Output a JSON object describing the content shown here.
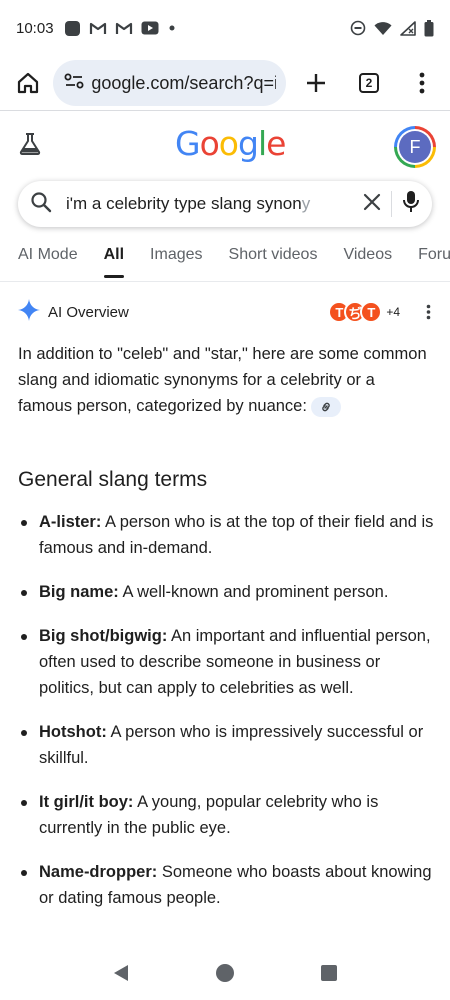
{
  "status_bar": {
    "time": "10:03",
    "icons_left": [
      "app-icon",
      "gmail-icon",
      "gmail-icon",
      "youtube-icon",
      "dot-icon"
    ],
    "icons_right": [
      "dnd-icon",
      "wifi-icon",
      "signal-icon",
      "battery-icon"
    ]
  },
  "browser": {
    "url": "google.com/search?q=i%",
    "tab_count": "2"
  },
  "header": {
    "logo": [
      {
        "ch": "G",
        "color": "#4285F4"
      },
      {
        "ch": "o",
        "color": "#EA4335"
      },
      {
        "ch": "o",
        "color": "#FBBC05"
      },
      {
        "ch": "g",
        "color": "#4285F4"
      },
      {
        "ch": "l",
        "color": "#34A853"
      },
      {
        "ch": "e",
        "color": "#EA4335"
      }
    ],
    "avatar_initial": "F"
  },
  "search": {
    "query": "i'm a celebrity type slang synony",
    "query_visible": "i'm a celebrity type slang synon",
    "query_faded": "y"
  },
  "tabs": [
    {
      "label": "AI Mode",
      "active": false
    },
    {
      "label": "All",
      "active": true
    },
    {
      "label": "Images",
      "active": false
    },
    {
      "label": "Short videos",
      "active": false
    },
    {
      "label": "Videos",
      "active": false
    },
    {
      "label": "Forur",
      "active": false
    }
  ],
  "ai_overview": {
    "title": "AI Overview",
    "sources_more": "+4",
    "source_badges": [
      "T",
      "ぢ",
      "T"
    ],
    "intro": "In addition to \"celeb\" and \"star,\" here are some common slang and idiomatic synonyms for a celebrity or a famous person, categorized by nuance:",
    "section_title": "General slang terms",
    "terms": [
      {
        "name": "A-lister:",
        "desc": " A person who is at the top of their field and is famous and in-demand."
      },
      {
        "name": "Big name:",
        "desc": " A well-known and prominent person."
      },
      {
        "name": "Big shot/bigwig:",
        "desc": " An important and influential person, often used to describe someone in business or politics, but can apply to celebrities as well."
      },
      {
        "name": "Hotshot:",
        "desc": " A person who is impressively successful or skillful."
      },
      {
        "name": "It girl/it boy:",
        "desc": " A young, popular celebrity who is currently in the public eye."
      },
      {
        "name": "Name-dropper:",
        "desc": " Someone who boasts about knowing or dating famous people."
      }
    ]
  },
  "nav": [
    "back-icon",
    "home-icon",
    "recents-icon"
  ],
  "colors": {
    "text": "#1f1f1f",
    "muted": "#5f6368",
    "url_bg": "#e9eef6",
    "avatar_bg": "#5c6bc0",
    "source_badge": "#f4511e",
    "gemini_blue": "#4285f4"
  }
}
